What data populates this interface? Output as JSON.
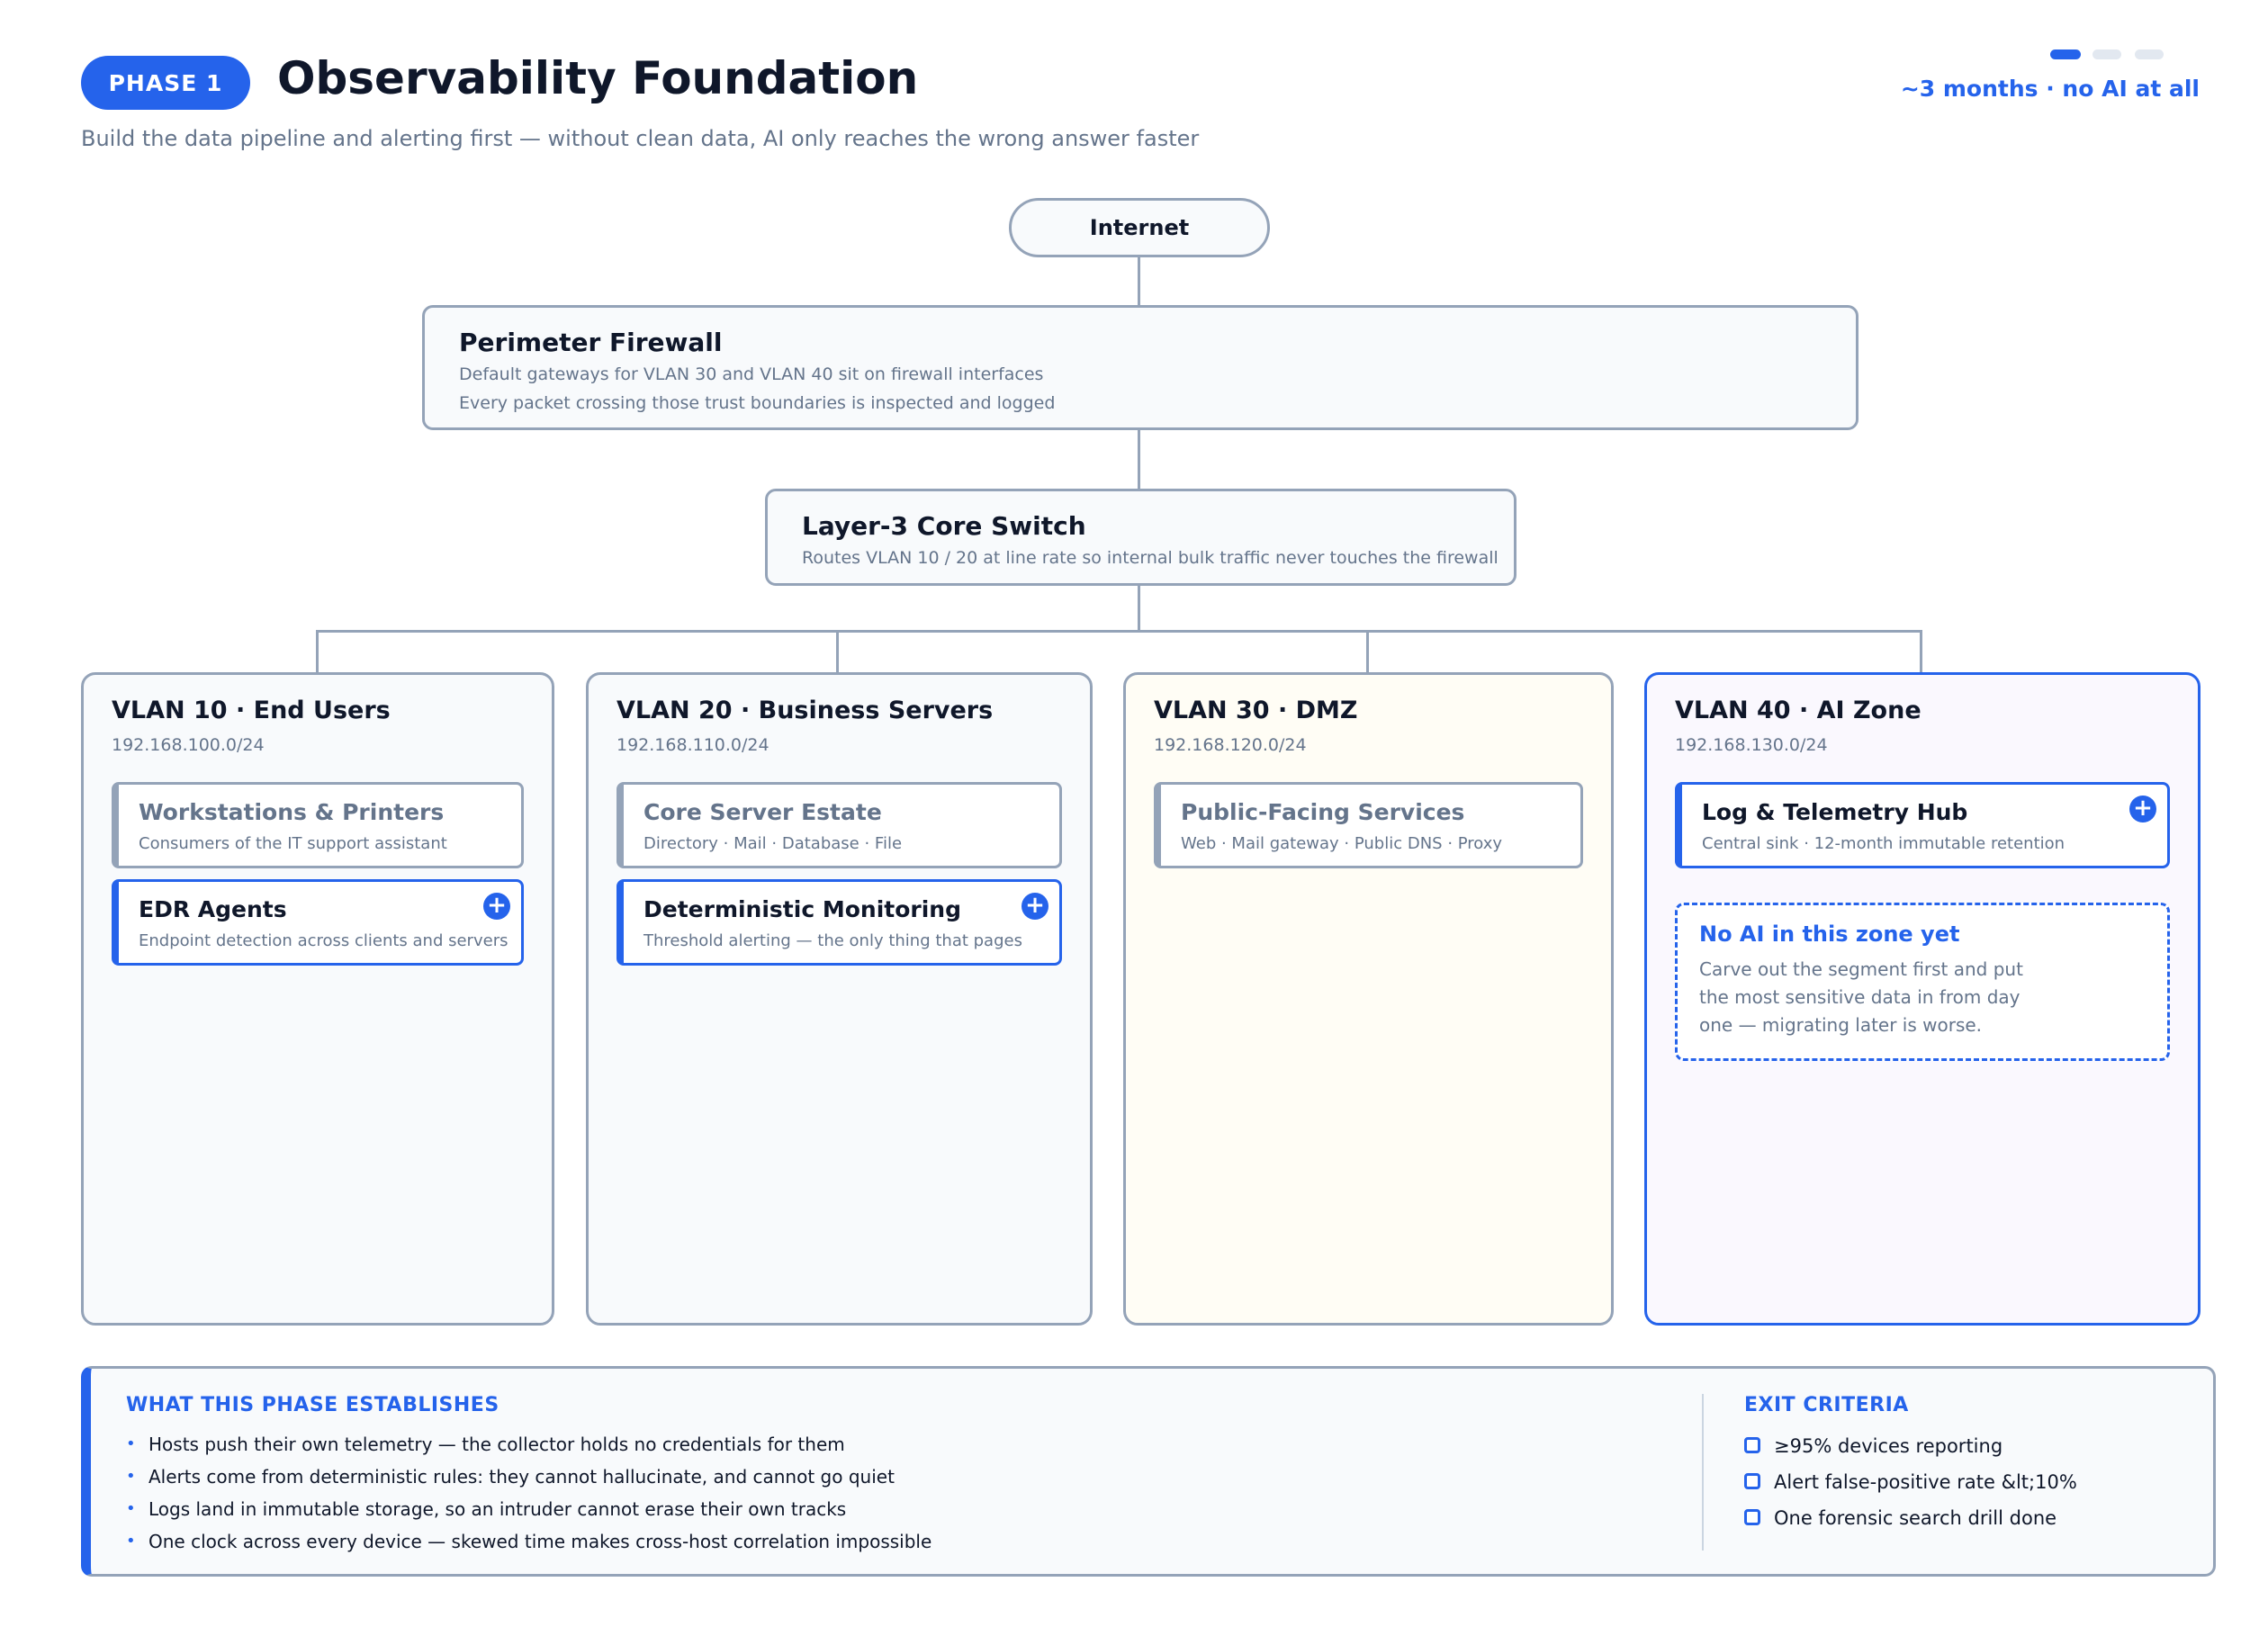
{
  "header": {
    "phase_label": "PHASE 1",
    "title": "Observability Foundation",
    "subtitle": "Build the data pipeline and alerting first — without clean data, AI only reaches the wrong answer faster",
    "duration": "~3 months · no AI at all",
    "progress": {
      "current_step": 1,
      "total_steps": 3
    }
  },
  "topology": {
    "internet": "Internet",
    "firewall": {
      "title": "Perimeter Firewall",
      "lines": [
        "Default gateways for VLAN 30 and VLAN 40 sit on firewall interfaces",
        "Every packet crossing those trust boundaries is inspected and logged"
      ]
    },
    "core_switch": {
      "title": "Layer-3 Core Switch",
      "line": "Routes VLAN 10 / 20 at line rate so internal bulk traffic never touches the firewall"
    }
  },
  "zones": [
    {
      "title": "VLAN 10 · End Users",
      "subnet": "192.168.100.0/24",
      "cards": [
        {
          "title": "Workstations & Printers",
          "desc": "Consumers of the IT support assistant",
          "state": "existing"
        },
        {
          "title": "EDR Agents",
          "desc": "Endpoint detection across clients and servers",
          "state": "new"
        }
      ]
    },
    {
      "title": "VLAN 20 · Business Servers",
      "subnet": "192.168.110.0/24",
      "cards": [
        {
          "title": "Core Server Estate",
          "desc": "Directory · Mail · Database · File",
          "state": "existing"
        },
        {
          "title": "Deterministic Monitoring",
          "desc": "Threshold alerting — the only thing that pages",
          "state": "new"
        }
      ]
    },
    {
      "title": "VLAN 30 · DMZ",
      "subnet": "192.168.120.0/24",
      "cards": [
        {
          "title": "Public-Facing Services",
          "desc": "Web · Mail gateway · Public DNS · Proxy",
          "state": "existing"
        }
      ]
    },
    {
      "title": "VLAN 40 · AI Zone",
      "subnet": "192.168.130.0/24",
      "cards": [
        {
          "title": "Log & Telemetry Hub",
          "desc": "Central sink · 12-month immutable retention",
          "state": "new"
        }
      ],
      "notice": {
        "title": "No AI in this zone yet",
        "body": "Carve out the segment first and put the most sensitive data in from day one — migrating later is worse."
      }
    }
  ],
  "add_marker": "+",
  "summary": {
    "establishes_heading": "WHAT THIS PHASE ESTABLISHES",
    "bullet": "•",
    "establishes": [
      "Hosts push their own telemetry — the collector holds no credentials for them",
      "Alerts come from deterministic rules: they cannot hallucinate, and cannot go quiet",
      "Logs land in immutable storage, so an intruder cannot erase their own tracks",
      "One clock across every device — skewed time makes cross-host correlation impossible"
    ],
    "exit_heading": "EXIT CRITERIA",
    "exit_criteria": [
      "≥95% devices reporting",
      "Alert false-positive rate &lt;10%",
      "One forensic search drill done"
    ]
  },
  "colors": {
    "accent": "#2563eb",
    "border": "#94a3b8",
    "muted_text": "#64748b",
    "dmz_fill": "#fffdf5",
    "ai_zone_fill": "#faf8fe"
  }
}
